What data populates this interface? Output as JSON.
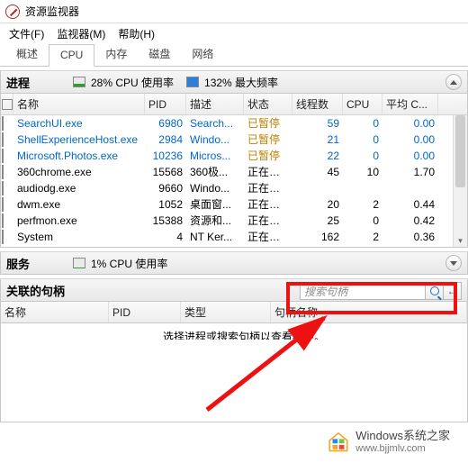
{
  "window": {
    "title": "资源监视器"
  },
  "menu": {
    "file": "文件(F)",
    "monitor": "监视器(M)",
    "help": "帮助(H)"
  },
  "tabs": {
    "overview": "概述",
    "cpu": "CPU",
    "memory": "内存",
    "disk": "磁盘",
    "network": "网络"
  },
  "processes": {
    "label": "进程",
    "cpu_meter": "28% CPU 使用率",
    "cpu_fill": 28,
    "freq_meter": "132% 最大频率",
    "freq_fill": 100,
    "columns": {
      "name": "名称",
      "pid": "PID",
      "desc": "描述",
      "status": "状态",
      "threads": "线程数",
      "cpu": "CPU",
      "avg": "平均 C..."
    },
    "rows": [
      {
        "name": "SearchUI.exe",
        "pid": "6980",
        "desc": "Search...",
        "status": "已暂停",
        "threads": "59",
        "cpu": "0",
        "avg": "0.00",
        "sus": true
      },
      {
        "name": "ShellExperienceHost.exe",
        "pid": "2984",
        "desc": "Windo...",
        "status": "已暂停",
        "threads": "21",
        "cpu": "0",
        "avg": "0.00",
        "sus": true
      },
      {
        "name": "Microsoft.Photos.exe",
        "pid": "10236",
        "desc": "Micros...",
        "status": "已暂停",
        "threads": "22",
        "cpu": "0",
        "avg": "0.00",
        "sus": true
      },
      {
        "name": "360chrome.exe",
        "pid": "15568",
        "desc": "360极...",
        "status": "正在运行",
        "threads": "45",
        "cpu": "10",
        "avg": "1.70",
        "sus": false
      },
      {
        "name": "audiodg.exe",
        "pid": "9660",
        "desc": "Windo...",
        "status": "正在运行",
        "threads": "",
        "cpu": "",
        "avg": "",
        "sus": false
      },
      {
        "name": "dwm.exe",
        "pid": "1052",
        "desc": "桌面窗...",
        "status": "正在运行",
        "threads": "20",
        "cpu": "2",
        "avg": "0.44",
        "sus": false
      },
      {
        "name": "perfmon.exe",
        "pid": "15388",
        "desc": "资源和...",
        "status": "正在运行",
        "threads": "25",
        "cpu": "0",
        "avg": "0.42",
        "sus": false
      },
      {
        "name": "System",
        "pid": "4",
        "desc": "NT Ker...",
        "status": "正在运行",
        "threads": "162",
        "cpu": "2",
        "avg": "0.36",
        "sus": false
      }
    ]
  },
  "services": {
    "label": "服务",
    "cpu_meter": "1% CPU 使用率",
    "cpu_fill": 1
  },
  "handles": {
    "label": "关联的句柄",
    "search_placeholder": "搜索句柄",
    "columns": {
      "name": "名称",
      "pid": "PID",
      "type": "类型",
      "hname": "句柄名称"
    },
    "empty_text": "选择进程或搜索句柄以查看结果。"
  },
  "watermark": {
    "text1": "Windows系统之家",
    "text2": "www.bjjmlv.com"
  }
}
